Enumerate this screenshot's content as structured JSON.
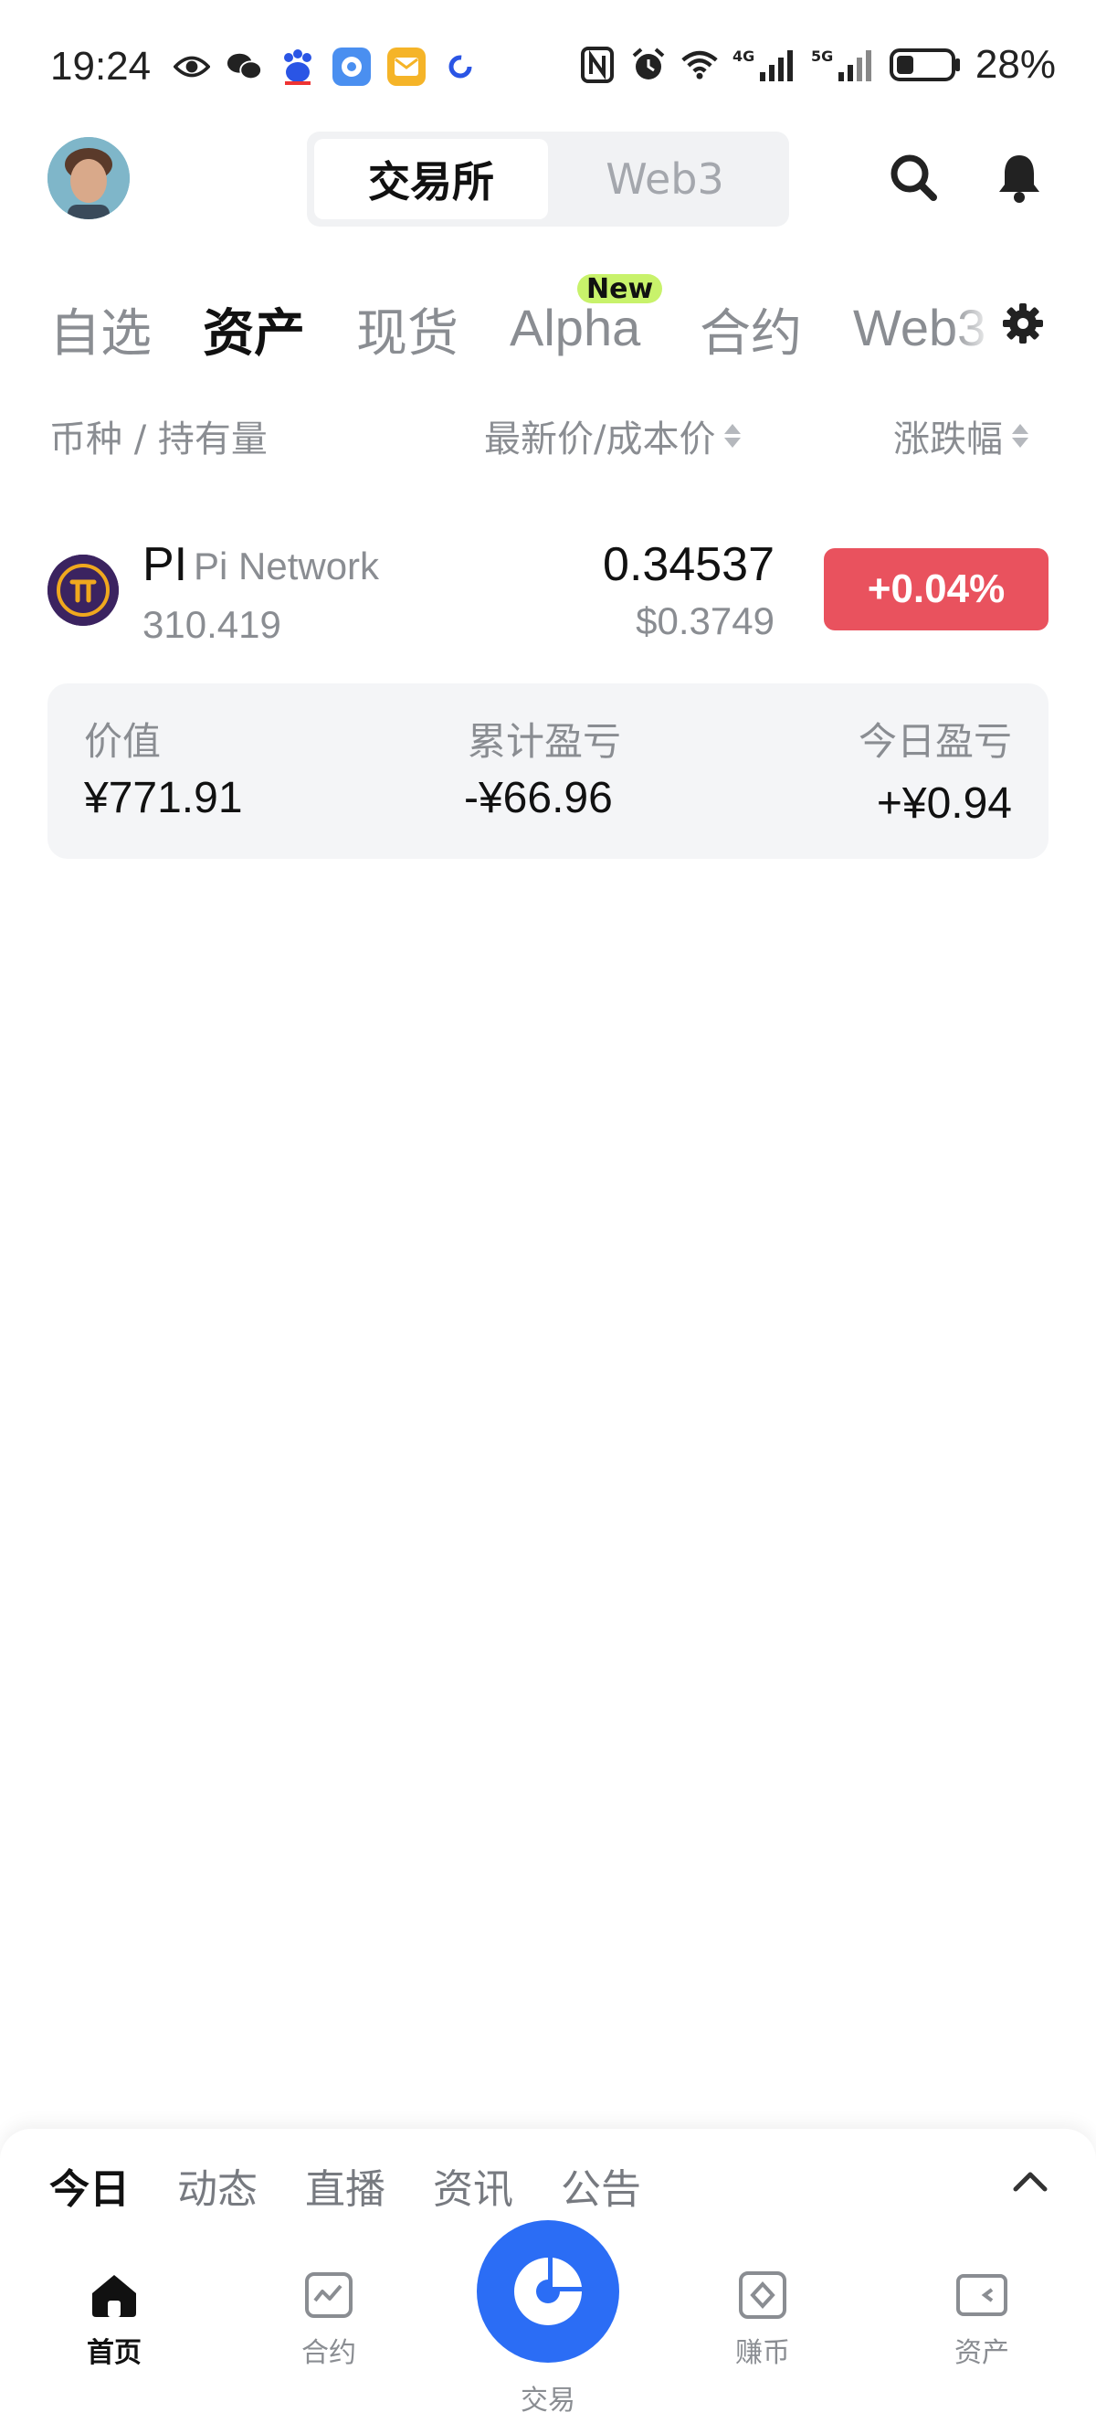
{
  "status_bar": {
    "time": "19:24",
    "battery_percent": "28%",
    "signal_labels": [
      "4G",
      "5G"
    ]
  },
  "header": {
    "segments": [
      {
        "label": "交易所",
        "active": true
      },
      {
        "label": "Web3",
        "active": false
      }
    ]
  },
  "tabs": {
    "items": [
      "自选",
      "资产",
      "现货",
      "Alpha",
      "合约",
      "Web3"
    ],
    "active": "资产",
    "new_badge": "New"
  },
  "columns": {
    "coin_holdings": "币种 / 持有量",
    "price_cost": "最新价/成本价",
    "change": "涨跌幅"
  },
  "asset": {
    "symbol": "PI",
    "name": "Pi Network",
    "holdings": "310.419",
    "price": "0.34537",
    "cost_price": "$0.3749",
    "change": "+0.04%",
    "change_color": "#e9525e"
  },
  "pnl": {
    "value_label": "价值",
    "value": "¥771.91",
    "cumulative_label": "累计盈亏",
    "cumulative": "-¥66.96",
    "today_label": "今日盈亏",
    "today": "+¥0.94"
  },
  "news_tabs": {
    "items": [
      "今日",
      "动态",
      "直播",
      "资讯",
      "公告"
    ],
    "active": "今日"
  },
  "bottom_nav": {
    "items": [
      {
        "label": "首页",
        "icon": "home-icon",
        "active": true
      },
      {
        "label": "合约",
        "icon": "chart-icon",
        "active": false
      },
      {
        "label": "交易",
        "icon": "trade-icon",
        "active": false
      },
      {
        "label": "赚币",
        "icon": "diamond-icon",
        "active": false
      },
      {
        "label": "资产",
        "icon": "wallet-icon",
        "active": false
      }
    ]
  },
  "colors": {
    "accent_blue": "#2b6df5",
    "down_red": "#e9525e",
    "badge_green": "#c8f26b"
  }
}
